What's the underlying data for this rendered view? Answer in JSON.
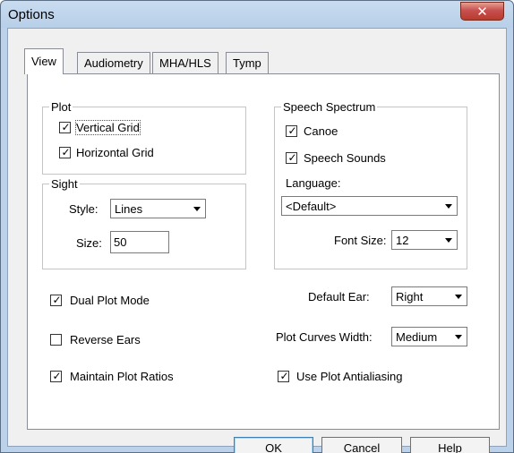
{
  "window": {
    "title": "Options",
    "close_glyph": "✕"
  },
  "tabs": [
    {
      "label": "View",
      "active": true
    },
    {
      "label": "Audiometry",
      "active": false
    },
    {
      "label": "MHA/HLS",
      "active": false
    },
    {
      "label": "Tymp",
      "active": false
    }
  ],
  "plot_group": {
    "title": "Plot",
    "vertical_grid": {
      "label": "Vertical Grid",
      "checked": true
    },
    "horizontal_grid": {
      "label": "Horizontal Grid",
      "checked": true
    }
  },
  "sight_group": {
    "title": "Sight",
    "style_label": "Style:",
    "style_value": "Lines",
    "size_label": "Size:",
    "size_value": "50"
  },
  "speech_group": {
    "title": "Speech Spectrum",
    "canoe": {
      "label": "Canoe",
      "checked": true
    },
    "speech_sounds": {
      "label": "Speech Sounds",
      "checked": true
    },
    "language_label": "Language:",
    "language_value": "<Default>",
    "font_size_label": "Font Size:",
    "font_size_value": "12"
  },
  "options": {
    "dual_plot_mode": {
      "label": "Dual Plot Mode",
      "checked": true
    },
    "reverse_ears": {
      "label": "Reverse Ears",
      "checked": false
    },
    "maintain_plot_ratios": {
      "label": "Maintain Plot Ratios",
      "checked": true
    },
    "use_plot_antialiasing": {
      "label": "Use Plot Antialiasing",
      "checked": true
    },
    "default_ear_label": "Default Ear:",
    "default_ear_value": "Right",
    "plot_curves_width_label": "Plot Curves Width:",
    "plot_curves_width_value": "Medium"
  },
  "buttons": {
    "ok": "OK",
    "cancel": "Cancel",
    "help": "Help"
  },
  "check_glyph": "✓",
  "colors": {
    "title_bar": "#bcd2ea",
    "close_button": "#c75050",
    "dialog_bg": "#f0f0f0"
  }
}
